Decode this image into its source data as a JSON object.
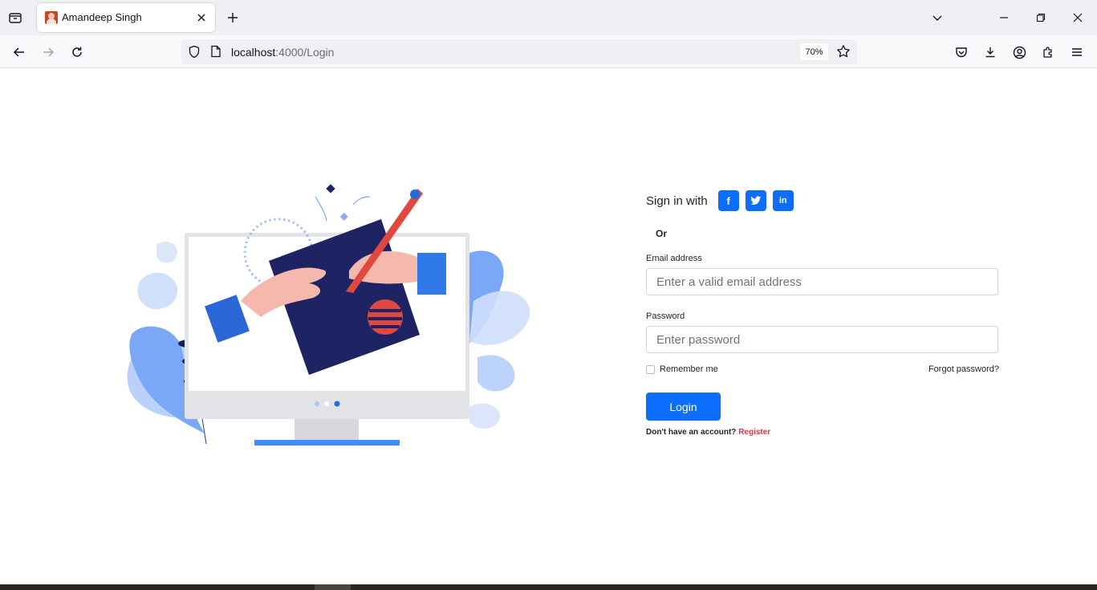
{
  "browser": {
    "tab_title": "Amandeep Singh",
    "url_host": "localhost",
    "url_path": ":4000/Login",
    "zoom": "70%"
  },
  "login": {
    "signin_label": "Sign in with",
    "social": [
      {
        "name": "facebook",
        "glyph": "f"
      },
      {
        "name": "twitter",
        "glyph": "t"
      },
      {
        "name": "linkedin",
        "glyph": "in"
      }
    ],
    "divider": "Or",
    "email_label": "Email address",
    "email_placeholder": "Enter a valid email address",
    "password_label": "Password",
    "password_placeholder": "Enter password",
    "remember_label": "Remember me",
    "forgot_label": "Forgot password?",
    "login_button": "Login",
    "register_prompt": "Don't have an account?",
    "register_link": "Register"
  },
  "colors": {
    "primary": "#0d6efd",
    "danger": "#dc3545"
  }
}
